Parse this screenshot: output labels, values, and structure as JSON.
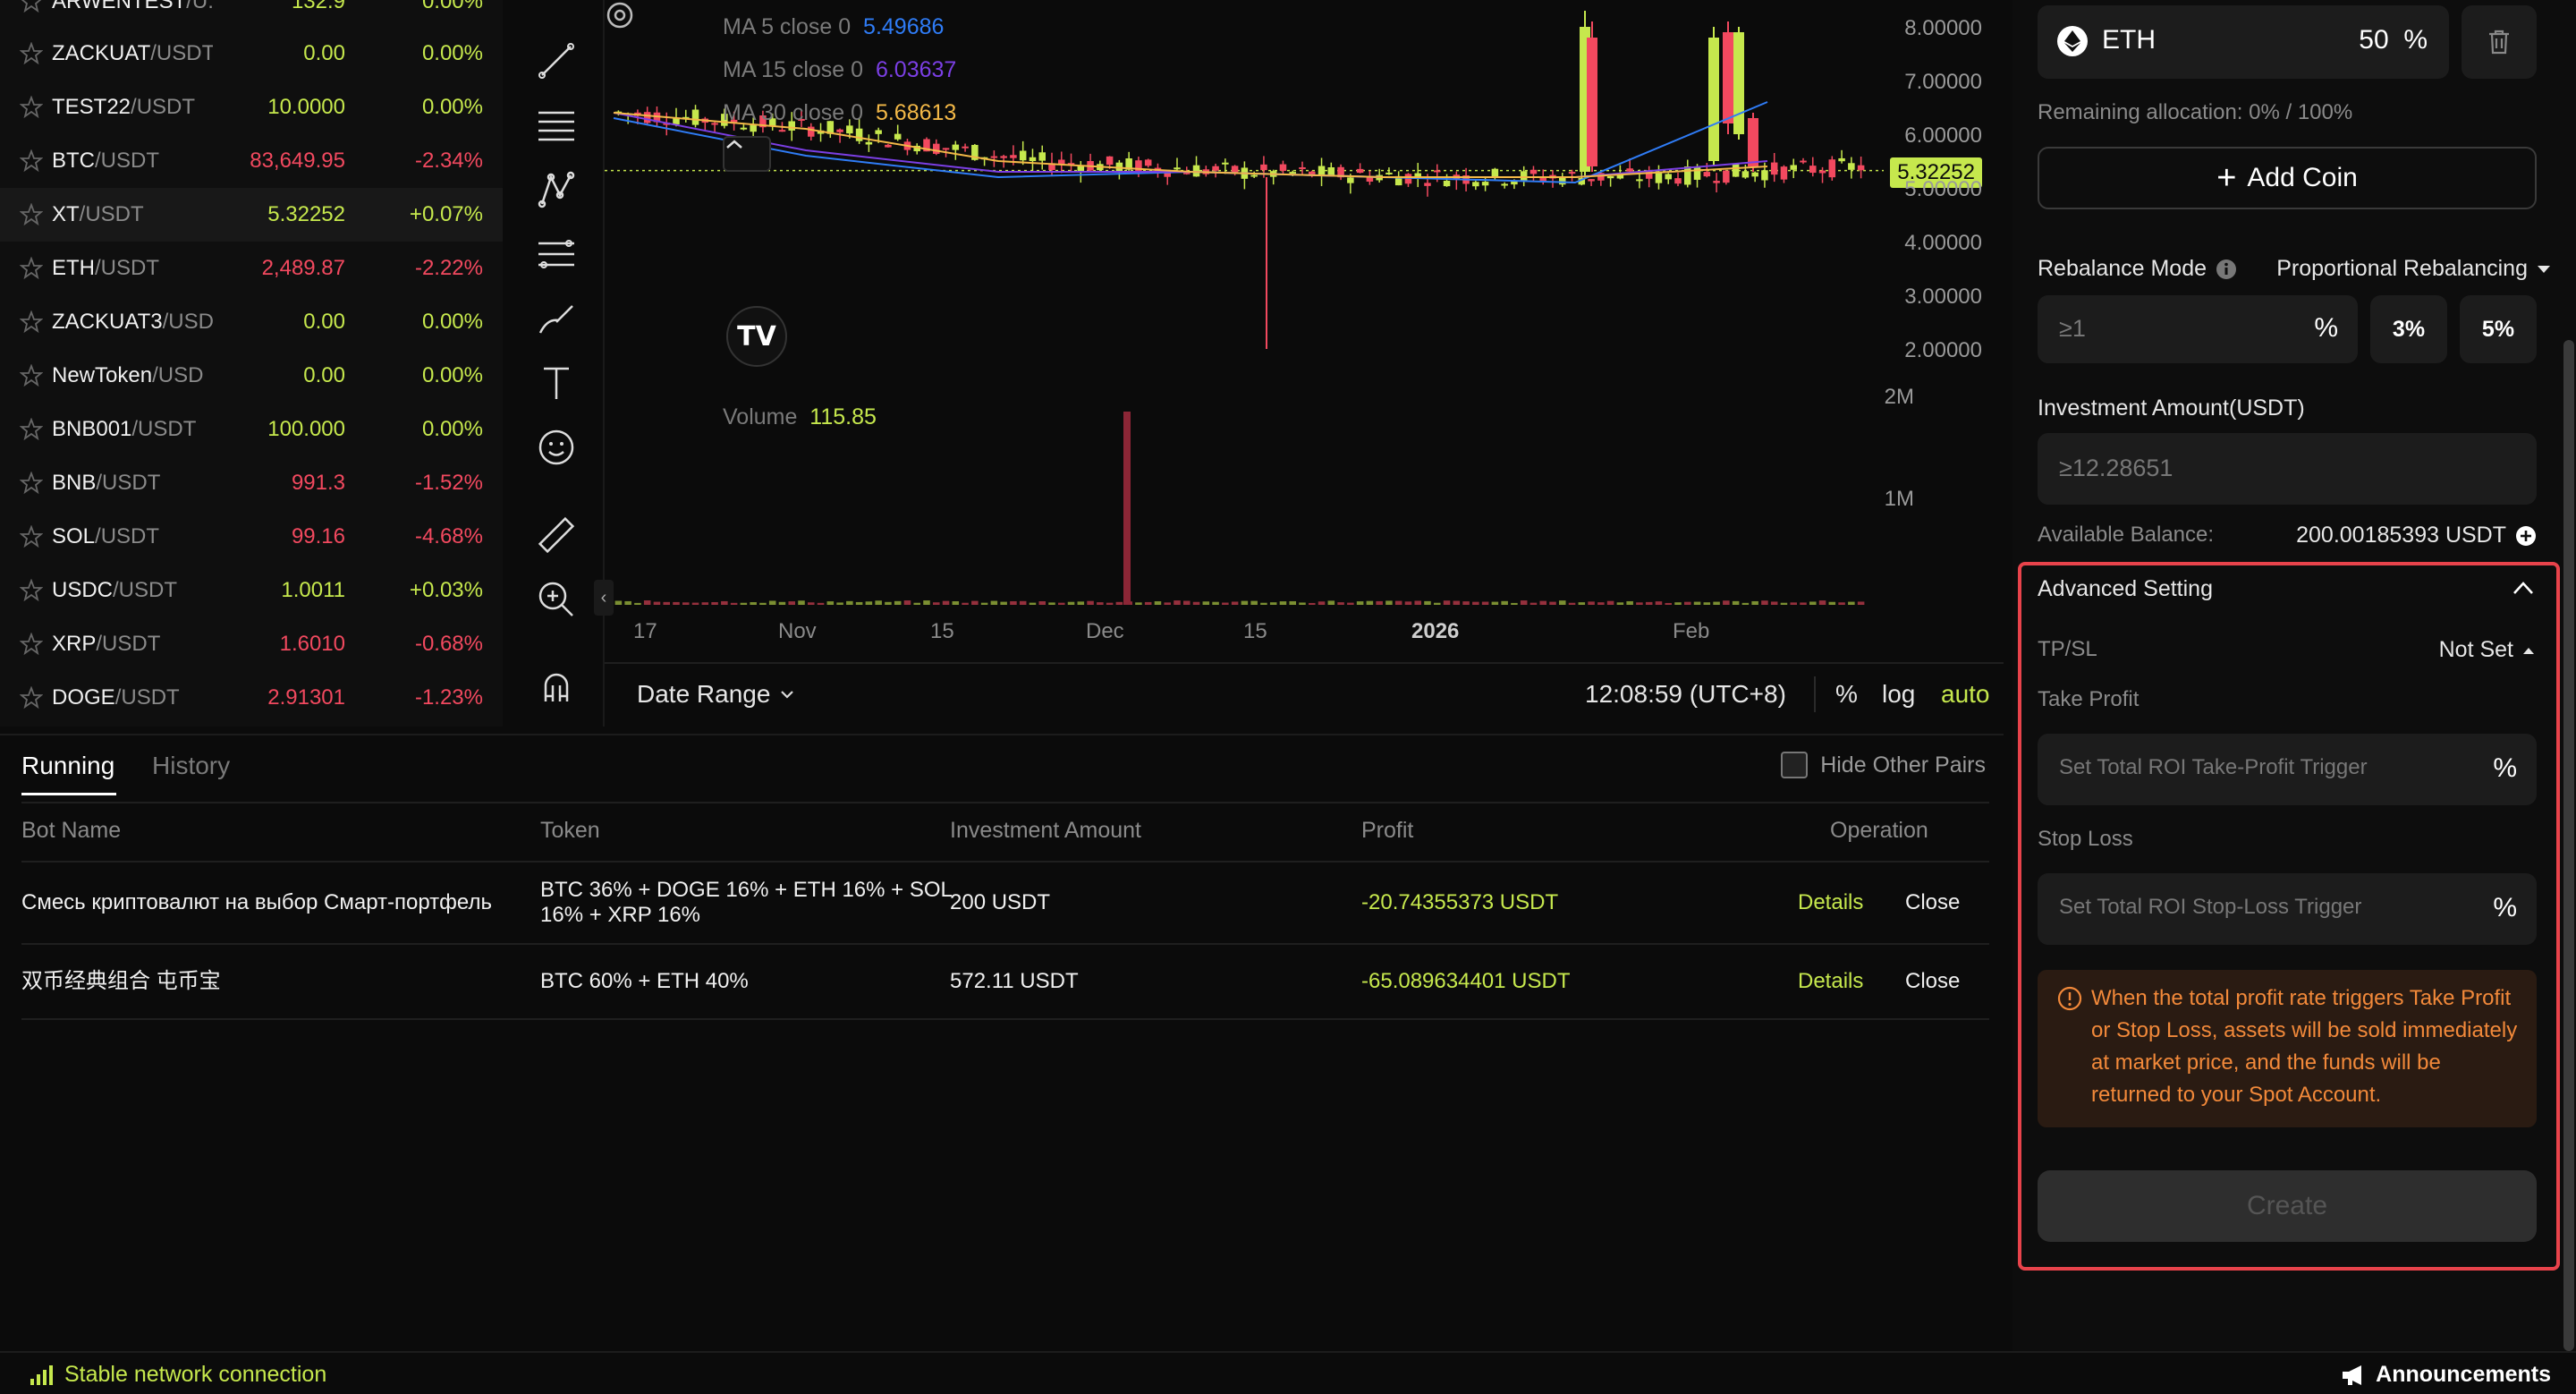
{
  "market_list": [
    {
      "base": "ARWENTEST",
      "quote": "/U:",
      "price": "132.9",
      "change": "0.00%",
      "dir": "up",
      "clipped": true
    },
    {
      "base": "ZACKUAT",
      "quote": "/USDT",
      "price": "0.00",
      "change": "0.00%",
      "dir": "up"
    },
    {
      "base": "TEST22",
      "quote": "/USDT",
      "price": "10.0000",
      "change": "0.00%",
      "dir": "up"
    },
    {
      "base": "BTC",
      "quote": "/USDT",
      "price": "83,649.95",
      "change": "-2.34%",
      "dir": "down"
    },
    {
      "base": "XT",
      "quote": "/USDT",
      "price": "5.32252",
      "change": "+0.07%",
      "dir": "up",
      "selected": true
    },
    {
      "base": "ETH",
      "quote": "/USDT",
      "price": "2,489.87",
      "change": "-2.22%",
      "dir": "down"
    },
    {
      "base": "ZACKUAT3",
      "quote": "/USD",
      "price": "0.00",
      "change": "0.00%",
      "dir": "up"
    },
    {
      "base": "NewToken",
      "quote": "/USD",
      "price": "0.00",
      "change": "0.00%",
      "dir": "up"
    },
    {
      "base": "BNB001",
      "quote": "/USDT",
      "price": "100.000",
      "change": "0.00%",
      "dir": "up"
    },
    {
      "base": "BNB",
      "quote": "/USDT",
      "price": "991.3",
      "change": "-1.52%",
      "dir": "down"
    },
    {
      "base": "SOL",
      "quote": "/USDT",
      "price": "99.16",
      "change": "-4.68%",
      "dir": "down"
    },
    {
      "base": "USDC",
      "quote": "/USDT",
      "price": "1.0011",
      "change": "+0.03%",
      "dir": "up"
    },
    {
      "base": "XRP",
      "quote": "/USDT",
      "price": "1.6010",
      "change": "-0.68%",
      "dir": "down"
    },
    {
      "base": "DOGE",
      "quote": "/USDT",
      "price": "2.91301",
      "change": "-1.23%",
      "dir": "down"
    }
  ],
  "chart": {
    "ma5_label": "MA 5 close 0",
    "ma5_value": "5.49686",
    "ma15_label": "MA 15 close 0",
    "ma15_value": "6.03637",
    "ma30_label": "MA 30 close 0",
    "ma30_value": "5.68613",
    "volume_label": "Volume",
    "volume_value": "115.85",
    "tv_logo": "TV",
    "last_price": "5.32252",
    "price_axis": [
      "8.00000",
      "7.00000",
      "6.00000",
      "5.00000",
      "4.00000",
      "3.00000",
      "2.00000"
    ],
    "volume_axis": [
      "2M",
      "1M"
    ],
    "time_axis": [
      "17",
      "Nov",
      "15",
      "Dec",
      "15",
      "2026",
      "Feb"
    ],
    "footer": {
      "date_range": "Date Range",
      "clock": "12:08:59 (UTC+8)",
      "percent": "%",
      "log": "log",
      "auto": "auto"
    },
    "colors": {
      "up": "#c6e84d",
      "down": "#f2495f",
      "ma5": "#2f7cf6",
      "ma15": "#7b3fe4",
      "ma30": "#f3b847"
    }
  },
  "chart_data": {
    "type": "line",
    "title": "",
    "x": [
      "17",
      "Nov",
      "15",
      "Dec",
      "15",
      "2026",
      "Feb"
    ],
    "ylim": [
      2,
      8
    ],
    "series": [
      {
        "name": "MA 5 close 0",
        "values": [
          6.3,
          5.6,
          5.2,
          5.3,
          5.2,
          5.1,
          6.6
        ]
      },
      {
        "name": "MA 15 close 0",
        "values": [
          6.4,
          5.7,
          5.3,
          5.3,
          5.2,
          5.2,
          5.5
        ]
      },
      {
        "name": "MA 30 close 0",
        "values": [
          6.4,
          6.1,
          5.5,
          5.3,
          5.2,
          5.2,
          5.4
        ]
      }
    ],
    "grid": false,
    "legend": "top-left"
  },
  "bots_panel": {
    "tabs": [
      "Running",
      "History"
    ],
    "hide_other_pairs": "Hide Other Pairs",
    "columns": [
      "Bot Name",
      "Token",
      "Investment Amount",
      "Profit",
      "Operation"
    ],
    "rows": [
      {
        "name": "Смесь криптовалют на выбор Смарт-портфель",
        "token_line1": "BTC 36% + DOGE 16% + ETH 16% + SOL",
        "token_line2": "16% + XRP 16%",
        "investment": "200 USDT",
        "profit": "-20.74355373 USDT",
        "details": "Details",
        "close": "Close"
      },
      {
        "name": "双币经典组合 屯币宝",
        "token_line1": "BTC 60% + ETH 40%",
        "token_line2": "",
        "investment": "572.11 USDT",
        "profit": "-65.089634401 USDT",
        "details": "Details",
        "close": "Close"
      }
    ]
  },
  "config": {
    "coin_name": "ETH",
    "coin_percent": "50",
    "percent_unit": "%",
    "remaining_allocation": "Remaining allocation: 0% / 100%",
    "add_coin": "Add Coin",
    "rebalance_mode_label": "Rebalance Mode",
    "rebalance_mode_value": "Proportional Rebalancing",
    "threshold_placeholder": "≥1",
    "threshold_chips": [
      "3%",
      "5%"
    ],
    "investment_label": "Investment Amount(USDT)",
    "investment_placeholder": "≥12.28651",
    "available_balance_label": "Available Balance:",
    "available_balance_value": "200.00185393 USDT",
    "advanced_setting": "Advanced Setting",
    "tpsl_label": "TP/SL",
    "tpsl_value": "Not Set",
    "take_profit_label": "Take Profit",
    "take_profit_placeholder": "Set Total ROI Take-Profit Trigger",
    "stop_loss_label": "Stop Loss",
    "stop_loss_placeholder": "Set Total ROI Stop-Loss Trigger",
    "warning": "When the total profit rate triggers Take Profit or Stop Loss, assets will be sold immediately at market price, and the funds will be returned to your Spot Account.",
    "create_button": "Create"
  },
  "status_bar": {
    "network": "Stable network connection",
    "announcements": "Announcements"
  }
}
